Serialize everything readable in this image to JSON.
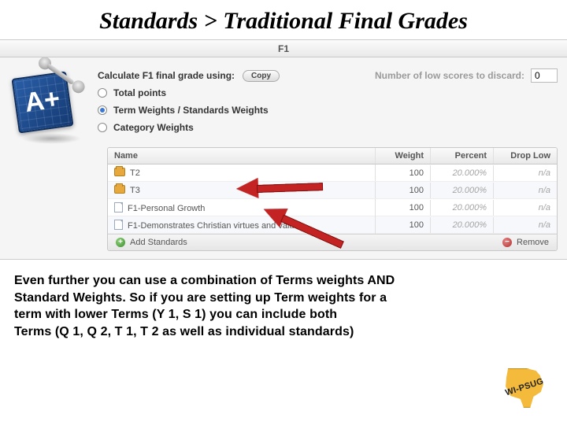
{
  "slide": {
    "title": "Standards > Traditional Final Grades",
    "body_line1": "Even further you can use a combination of Terms weights AND",
    "body_line2": "Standard Weights.  So if you are setting up Term weights for a",
    "body_line3": "term with lower Terms (Y 1, S 1) you can include both",
    "body_line4": "Terms (Q 1, Q 2, T 1, T 2 as well as individual standards)"
  },
  "header": {
    "term_tab": "F1"
  },
  "calc": {
    "label": "Calculate F1 final grade using:",
    "copy_btn": "Copy",
    "opt_total": "Total points",
    "opt_term": "Term Weights / Standards Weights",
    "opt_cat": "Category Weights",
    "discard_label": "Number of low scores to discard:",
    "discard_value": "0"
  },
  "table": {
    "headers": {
      "name": "Name",
      "weight": "Weight",
      "percent": "Percent",
      "drop": "Drop Low"
    },
    "rows": [
      {
        "icon": "folder",
        "name": "T2",
        "weight": "100",
        "percent": "20.000%",
        "drop": "n/a"
      },
      {
        "icon": "folder",
        "name": "T3",
        "weight": "100",
        "percent": "20.000%",
        "drop": "n/a"
      },
      {
        "icon": "page",
        "name": "F1-Personal Growth",
        "weight": "100",
        "percent": "20.000%",
        "drop": "n/a"
      },
      {
        "icon": "page",
        "name": "F1-Demonstrates Christian virtues and values",
        "weight": "100",
        "percent": "20.000%",
        "drop": "n/a"
      }
    ],
    "add_label": "Add Standards",
    "remove_label": "Remove"
  },
  "badge": {
    "text": "WI-PSUG"
  }
}
